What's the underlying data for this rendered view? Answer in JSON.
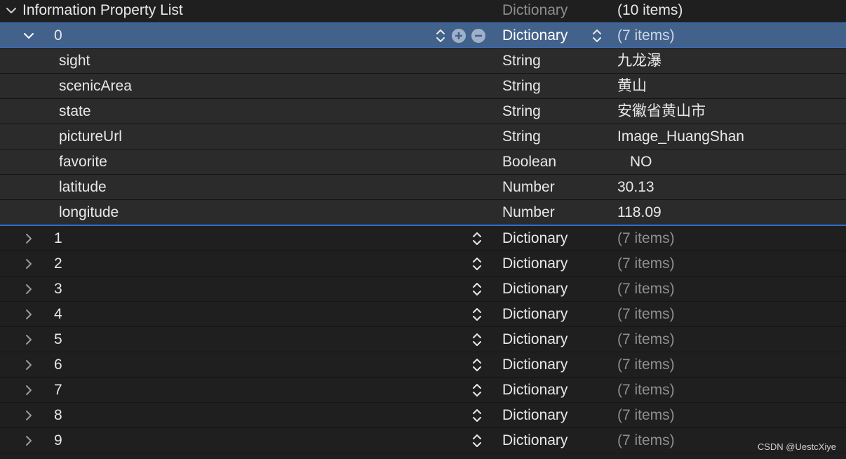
{
  "root": {
    "key": "Information Property List",
    "type": "Dictionary",
    "value": "(10 items)",
    "expanded": true
  },
  "selected": {
    "index": "0",
    "type": "Dictionary",
    "value": "(7 items)",
    "expanded": true
  },
  "children": [
    {
      "key": "sight",
      "type": "String",
      "value": "九龙瀑"
    },
    {
      "key": "scenicArea",
      "type": "String",
      "value": "黄山"
    },
    {
      "key": "state",
      "type": "String",
      "value": "安徽省黄山市"
    },
    {
      "key": "pictureUrl",
      "type": "String",
      "value": "Image_HuangShan"
    },
    {
      "key": "favorite",
      "type": "Boolean",
      "value": "NO"
    },
    {
      "key": "latitude",
      "type": "Number",
      "value": "30.13"
    },
    {
      "key": "longitude",
      "type": "Number",
      "value": "118.09"
    }
  ],
  "items": [
    {
      "index": "1",
      "type": "Dictionary",
      "value": "(7 items)"
    },
    {
      "index": "2",
      "type": "Dictionary",
      "value": "(7 items)"
    },
    {
      "index": "3",
      "type": "Dictionary",
      "value": "(7 items)"
    },
    {
      "index": "4",
      "type": "Dictionary",
      "value": "(7 items)"
    },
    {
      "index": "5",
      "type": "Dictionary",
      "value": "(7 items)"
    },
    {
      "index": "6",
      "type": "Dictionary",
      "value": "(7 items)"
    },
    {
      "index": "7",
      "type": "Dictionary",
      "value": "(7 items)"
    },
    {
      "index": "8",
      "type": "Dictionary",
      "value": "(7 items)"
    },
    {
      "index": "9",
      "type": "Dictionary",
      "value": "(7 items)"
    }
  ],
  "watermark": "CSDN @UestcXiye",
  "colors": {
    "selection": "#43628b",
    "accent": "#2f6fd1",
    "background": "#1f1f1f",
    "child_background": "#2b2b2b"
  }
}
